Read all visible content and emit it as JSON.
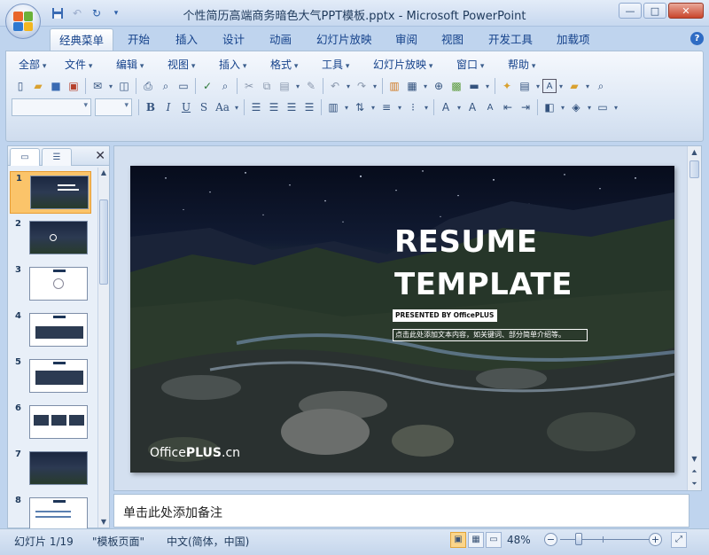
{
  "window": {
    "title": "个性简历高端商务暗色大气PPT模板.pptx - Microsoft PowerPoint"
  },
  "ribbon_tabs": [
    "经典菜单",
    "开始",
    "插入",
    "设计",
    "动画",
    "幻灯片放映",
    "审阅",
    "视图",
    "开发工具",
    "加载项"
  ],
  "classic_menu": [
    "全部",
    "文件",
    "编辑",
    "视图",
    "插入",
    "格式",
    "工具",
    "幻灯片放映",
    "窗口",
    "帮助"
  ],
  "thumbnails": [
    {
      "num": "1",
      "theme": "dark",
      "selected": true
    },
    {
      "num": "2",
      "theme": "dark",
      "selected": false
    },
    {
      "num": "3",
      "theme": "light",
      "selected": false
    },
    {
      "num": "4",
      "theme": "light",
      "selected": false
    },
    {
      "num": "5",
      "theme": "light",
      "selected": false
    },
    {
      "num": "6",
      "theme": "light",
      "selected": false
    },
    {
      "num": "7",
      "theme": "dark",
      "selected": false
    },
    {
      "num": "8",
      "theme": "light",
      "selected": false
    }
  ],
  "slide": {
    "title_line1": "RESUME",
    "title_line2": "TEMPLATE",
    "presented_by": "PRESENTED BY OfficePLUS",
    "description": "点击此处添加文本内容，如关键词、部分简单介绍等。",
    "brand_prefix": "Office",
    "brand_bold": "PLUS",
    "brand_suffix": ".cn"
  },
  "notes": {
    "placeholder": "单击此处添加备注"
  },
  "statusbar": {
    "slide_counter": "幻灯片 1/19",
    "theme_name": "\"模板页面\"",
    "language": "中文(简体，中国)",
    "zoom": "48%",
    "zoom_level": 0.48
  },
  "colors": {
    "accent": "#15428b",
    "selected_thumb": "#fbc46a"
  }
}
